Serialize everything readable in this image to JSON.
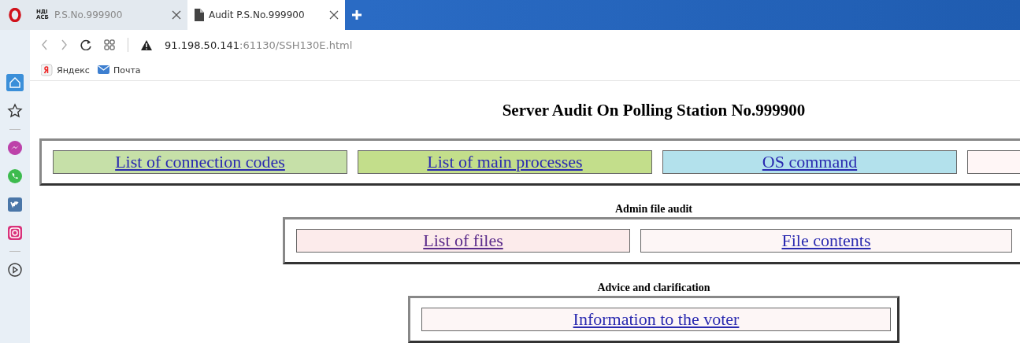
{
  "browser": {
    "tabs": [
      {
        "favicon_text": "НДІ АСБ",
        "title": "P.S.No.999900",
        "selected": false
      },
      {
        "title": "Audit P.S.No.999900",
        "selected": true
      }
    ],
    "address": {
      "host": "91.198.50.141",
      "rest": ":61130/SSH130E.html"
    },
    "bookmarks": [
      {
        "label": "Яндекс",
        "kind": "yandex"
      },
      {
        "label": "Почта",
        "kind": "mail"
      }
    ],
    "sidebar": [
      {
        "kind": "home",
        "selected": true
      },
      {
        "kind": "star",
        "selected": false
      },
      {
        "kind": "divider"
      },
      {
        "kind": "messenger",
        "selected": false
      },
      {
        "kind": "whatsapp",
        "selected": false
      },
      {
        "kind": "vk",
        "selected": false
      },
      {
        "kind": "instagram",
        "selected": false
      },
      {
        "kind": "divider"
      },
      {
        "kind": "player",
        "selected": false
      }
    ]
  },
  "page": {
    "title": "Server Audit On Polling Station No.999900",
    "sections": [
      {
        "links": [
          {
            "label": "List of connection codes",
            "color": "#c6e0a8",
            "visited": false
          },
          {
            "label": "List of main processes",
            "color": "#c3de8b",
            "visited": false
          },
          {
            "label": "OS command",
            "color": "#b3e1ec",
            "visited": false
          },
          {
            "color": "#fff6f6"
          }
        ]
      },
      {
        "heading": "Admin file audit",
        "links": [
          {
            "label": "List of files",
            "color": "#fcebeb",
            "visited": true
          },
          {
            "label": "File contents",
            "color": "#fdf6f6",
            "visited": false
          }
        ]
      },
      {
        "heading": "Advice and clarification",
        "links": [
          {
            "label": "Information to the voter",
            "color": "#fdf6f6",
            "visited": false
          }
        ]
      }
    ]
  }
}
